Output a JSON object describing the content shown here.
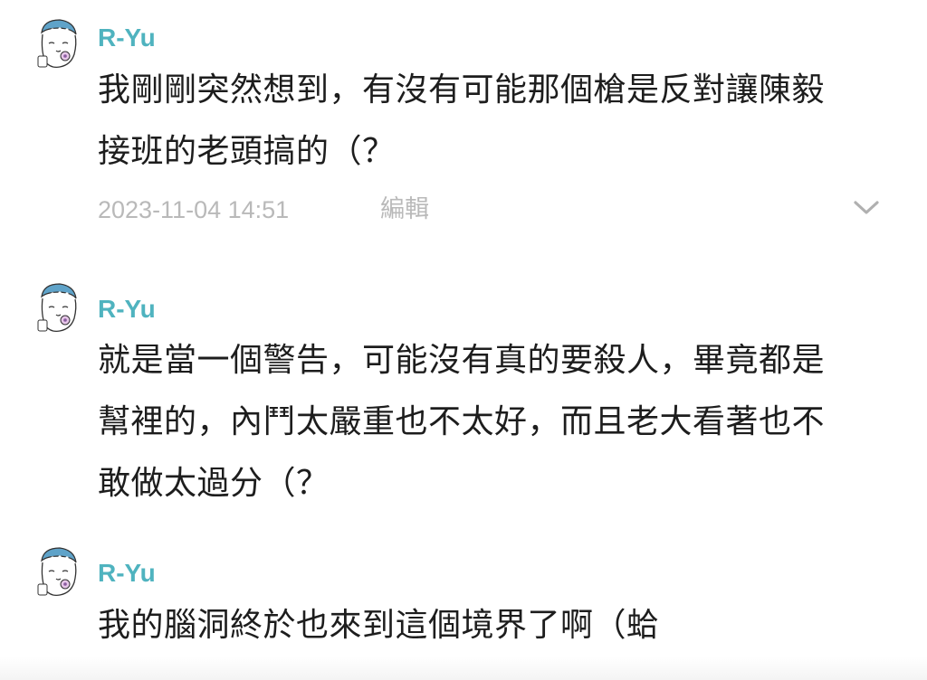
{
  "comments": [
    {
      "author": "R-Yu",
      "lines": [
        "我剛剛突然想到，有沒有可能那個槍是反對讓陳毅",
        "接班的老頭搞的（？"
      ],
      "timestamp": "2023-11-04 14:51",
      "edit_label": "編輯",
      "menu_icon": "chevron-down-icon"
    },
    {
      "author": "R-Yu",
      "lines": [
        "就是當一個警告，可能沒有真的要殺人，畢竟都是",
        "幫裡的，內鬥太嚴重也不太好，而且老大看著也不",
        "敢做太過分（？"
      ]
    },
    {
      "author": "R-Yu",
      "lines": [
        "我的腦洞終於也來到這個境界了啊（蛤"
      ]
    }
  ],
  "colors": {
    "author": "#4fb3bf",
    "body_text": "#1d1d1d",
    "meta_text": "#b9b9b9"
  }
}
